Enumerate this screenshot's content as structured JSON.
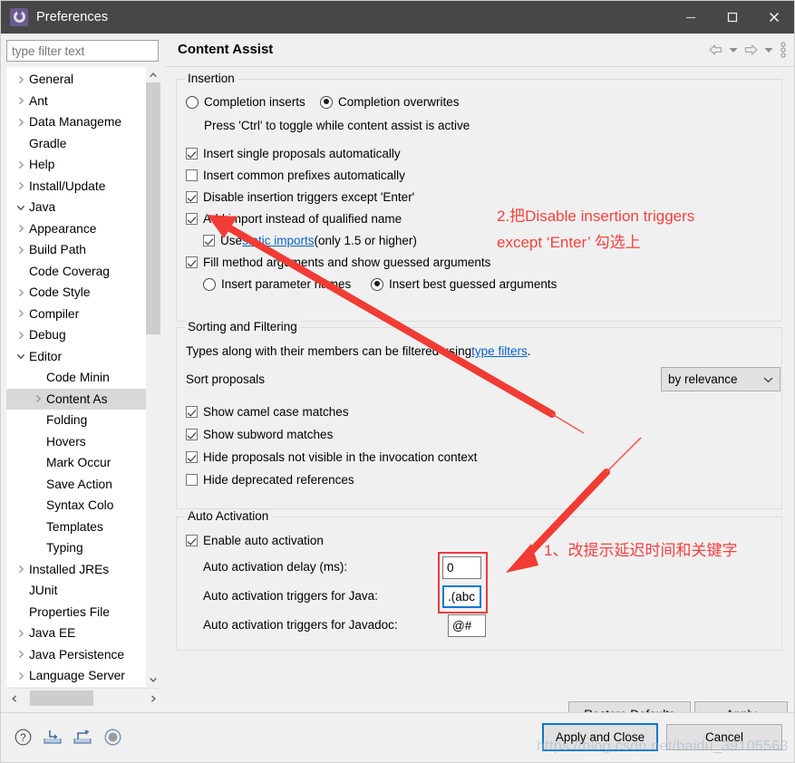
{
  "window": {
    "title": "Preferences",
    "icon": "preferences-gear-icon",
    "minimize_label": "—",
    "maximize_label": "□",
    "close_label": "✕"
  },
  "sidebar": {
    "filter": {
      "value": "",
      "placeholder": "type filter text"
    },
    "items": [
      {
        "label": "General",
        "indent": 0,
        "twisty": "collapsed",
        "selected": false
      },
      {
        "label": "Ant",
        "indent": 0,
        "twisty": "collapsed",
        "selected": false
      },
      {
        "label": "Data Manageme",
        "indent": 0,
        "twisty": "collapsed",
        "selected": false
      },
      {
        "label": "Gradle",
        "indent": 0,
        "twisty": "none",
        "selected": false
      },
      {
        "label": "Help",
        "indent": 0,
        "twisty": "collapsed",
        "selected": false
      },
      {
        "label": "Install/Update",
        "indent": 0,
        "twisty": "collapsed",
        "selected": false
      },
      {
        "label": "Java",
        "indent": 0,
        "twisty": "expanded",
        "selected": false
      },
      {
        "label": "Appearance",
        "indent": 1,
        "twisty": "collapsed",
        "selected": false
      },
      {
        "label": "Build Path",
        "indent": 1,
        "twisty": "collapsed",
        "selected": false
      },
      {
        "label": "Code Coverag",
        "indent": 1,
        "twisty": "none",
        "selected": false
      },
      {
        "label": "Code Style",
        "indent": 1,
        "twisty": "collapsed",
        "selected": false
      },
      {
        "label": "Compiler",
        "indent": 1,
        "twisty": "collapsed",
        "selected": false
      },
      {
        "label": "Debug",
        "indent": 1,
        "twisty": "collapsed",
        "selected": false
      },
      {
        "label": "Editor",
        "indent": 1,
        "twisty": "expanded",
        "selected": false
      },
      {
        "label": "Code Minin",
        "indent": 2,
        "twisty": "none",
        "selected": false
      },
      {
        "label": "Content As",
        "indent": 2,
        "twisty": "collapsed",
        "selected": true
      },
      {
        "label": "Folding",
        "indent": 2,
        "twisty": "none",
        "selected": false
      },
      {
        "label": "Hovers",
        "indent": 2,
        "twisty": "none",
        "selected": false
      },
      {
        "label": "Mark Occur",
        "indent": 2,
        "twisty": "none",
        "selected": false
      },
      {
        "label": "Save Action",
        "indent": 2,
        "twisty": "none",
        "selected": false
      },
      {
        "label": "Syntax Colo",
        "indent": 2,
        "twisty": "none",
        "selected": false
      },
      {
        "label": "Templates",
        "indent": 2,
        "twisty": "none",
        "selected": false
      },
      {
        "label": "Typing",
        "indent": 2,
        "twisty": "none",
        "selected": false
      },
      {
        "label": "Installed JREs",
        "indent": 1,
        "twisty": "collapsed",
        "selected": false
      },
      {
        "label": "JUnit",
        "indent": 1,
        "twisty": "none",
        "selected": false
      },
      {
        "label": "Properties File",
        "indent": 1,
        "twisty": "none",
        "selected": false
      },
      {
        "label": "Java EE",
        "indent": 0,
        "twisty": "collapsed",
        "selected": false
      },
      {
        "label": "Java Persistence",
        "indent": 0,
        "twisty": "collapsed",
        "selected": false
      },
      {
        "label": "Language Server",
        "indent": 0,
        "twisty": "collapsed",
        "selected": false
      }
    ]
  },
  "page": {
    "title": "Content Assist",
    "toolbar": {
      "back": "back-arrow",
      "back_menu": "back-dropdown",
      "forward": "forward-arrow",
      "forward_menu": "forward-dropdown",
      "menu": "view-menu"
    },
    "insertion": {
      "group_label": "Insertion",
      "radio_inserts": {
        "label": "Completion inserts",
        "checked": false
      },
      "radio_overwrites": {
        "label": "Completion overwrites",
        "checked": true
      },
      "hint": "Press 'Ctrl' to toggle while content assist is active",
      "checks": [
        {
          "label": "Insert single proposals automatically",
          "checked": true
        },
        {
          "label": "Insert common prefixes automatically",
          "checked": false
        },
        {
          "label": "Disable insertion triggers except 'Enter'",
          "checked": true
        },
        {
          "label": "Add import instead of qualified name",
          "checked": true
        }
      ],
      "static_imports": {
        "prefix": "Use ",
        "link": "static imports",
        "suffix": " (only 1.5 or higher)",
        "checked": true
      },
      "fill_args": {
        "label": "Fill method arguments and show guessed arguments",
        "checked": true
      },
      "radio_param_names": {
        "label": "Insert parameter names",
        "checked": false
      },
      "radio_best_guessed": {
        "label": "Insert best guessed arguments",
        "checked": true
      }
    },
    "sorting": {
      "group_label": "Sorting and Filtering",
      "description_prefix": "Types along with their members can be filtered using ",
      "description_link": "type filters",
      "description_suffix": ".",
      "sort_label": "Sort proposals",
      "sort_value": "by relevance",
      "checks": [
        {
          "label": "Show camel case matches",
          "checked": true
        },
        {
          "label": "Show subword matches",
          "checked": true
        },
        {
          "label": "Hide proposals not visible in the invocation context",
          "checked": true
        },
        {
          "label": "Hide deprecated references",
          "checked": false
        }
      ]
    },
    "auto_activation": {
      "group_label": "Auto Activation",
      "enable": {
        "label": "Enable auto activation",
        "checked": true
      },
      "delay_label": "Auto activation delay (ms):",
      "delay_value": "0",
      "java_label": "Auto activation triggers for Java:",
      "java_value": ".(abc",
      "javadoc_label": "Auto activation triggers for Javadoc:",
      "javadoc_value": "@#"
    },
    "buttons": {
      "restore_defaults": "Restore Defaults",
      "apply": "Apply"
    }
  },
  "footer": {
    "icons": [
      {
        "name": "help-icon"
      },
      {
        "name": "import-preferences-icon"
      },
      {
        "name": "export-preferences-icon"
      },
      {
        "name": "record-icon"
      }
    ],
    "apply_and_close": "Apply and Close",
    "cancel": "Cancel"
  },
  "annotations": {
    "note1": "1、改提示延迟时间和关键字",
    "note2_line1": "2.把Disable insertion triggers",
    "note2_line2": "except ‘Enter’ 勾选上",
    "color": "#f5413f"
  },
  "watermark": "https://blog.csdn.net/baidu_39105563"
}
